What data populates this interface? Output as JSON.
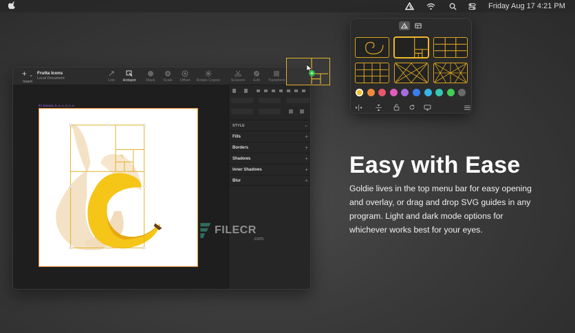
{
  "menubar": {
    "datetime": "Friday Aug 17  4:21 PM",
    "icons": [
      "apple-icon",
      "goldie-icon",
      "wifi-icon",
      "search-icon",
      "control-center-icon"
    ]
  },
  "popup": {
    "tabs": [
      "guides-tab-icon",
      "layout-tab-icon"
    ],
    "guides": [
      "golden-spiral",
      "golden-ratio",
      "thirds",
      "grid",
      "diagonals",
      "harmonic"
    ],
    "colors": [
      "#f2c12e",
      "#f08a3a",
      "#e9566a",
      "#e35bbf",
      "#a56de0",
      "#3a7df0",
      "#35b7e8",
      "#36c7b6",
      "#3fcf56",
      "#6a6a6a"
    ],
    "selected_color": "#f2c12e",
    "tools": [
      "flip-horizontal-icon",
      "flip-vertical-icon",
      "lock-icon",
      "rotate-icon",
      "display-icon",
      "menu-icon"
    ]
  },
  "window": {
    "insert_label": "Insert",
    "doc_title": "Frutta Icons",
    "doc_subtitle": "Local Document",
    "toolbar_items": [
      "Link",
      "Hotspot",
      "Mask",
      "Scale",
      "Offset",
      "Rotate Copies",
      "Scissors",
      "Edit",
      "Transform"
    ],
    "active_item": "Hotspot",
    "artboard_label": "it's banana, b, a, n, a, n, a",
    "inspector": {
      "style_label": "STYLE",
      "sections": [
        "Fills",
        "Borders",
        "Shadows",
        "Inner Shadows",
        "Blur"
      ]
    }
  },
  "hero": {
    "title": "Easy with Ease",
    "body": "Goldie lives in the top menu bar for easy opening and overlay, or drag and drop SVG guides in any program. Light and dark mode options for whichever works best for your eyes."
  },
  "watermark": {
    "text": "FILECR",
    "suffix": ".com"
  },
  "colors": {
    "accent_gold": "#e2b12a",
    "artboard_border": "#e8892a",
    "banana_yellow": "#f5c518"
  }
}
